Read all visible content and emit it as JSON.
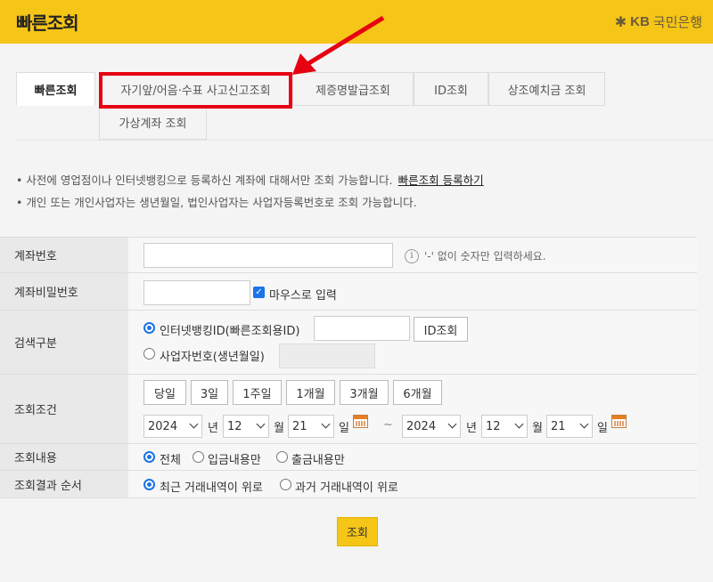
{
  "header": {
    "title": "빠른조회",
    "logo_text": "국민은행",
    "logo_kb": "KB",
    "logo_icon": "kb-star-icon"
  },
  "tabs": [
    {
      "label": "빠른조회",
      "active": true
    },
    {
      "label": "자기앞/어음·수표 사고신고조회",
      "active": false
    },
    {
      "label": "제증명발급조회",
      "active": false
    },
    {
      "label": "ID조회",
      "active": false
    },
    {
      "label": "상조예치금 조회",
      "active": false
    },
    {
      "label": "가상계좌 조회",
      "active": false
    }
  ],
  "notes": {
    "line1": "• 사전에 영업점이나 인터넷뱅킹으로 등록하신 계좌에 대해서만 조회 가능합니다.",
    "line1_link": "빠른조회 등록하기",
    "line2": "• 개인 또는 개인사업자는 생년월일, 법인사업자는 사업자등록번호로 조회 가능합니다."
  },
  "form": {
    "account_number": {
      "label": "계좌번호",
      "value": "",
      "hint": "'-' 없이 숫자만 입력하세요.",
      "info_icon": "i"
    },
    "account_password": {
      "label": "계좌비밀번호",
      "value": "",
      "mouse_input_label": "마우스로 입력",
      "mouse_input_checked": true
    },
    "search_type": {
      "label": "검색구분",
      "option1": "인터넷뱅킹ID(빠른조회용ID)",
      "option2": "사업자번호(생년월일)",
      "id_button": "ID조회",
      "selected": "option1"
    },
    "condition": {
      "label": "조회조건",
      "quick_buttons": [
        "당일",
        "3일",
        "1주일",
        "1개월",
        "3개월",
        "6개월"
      ],
      "from": {
        "year": "2024",
        "month": "12",
        "day": "21"
      },
      "to": {
        "year": "2024",
        "month": "12",
        "day": "21"
      },
      "year_unit": "년",
      "month_unit": "월",
      "day_unit": "일",
      "separator": "~"
    },
    "content": {
      "label": "조회내용",
      "options": [
        "전체",
        "입금내용만",
        "출금내용만"
      ],
      "selected": "전체"
    },
    "order": {
      "label": "조회결과 순서",
      "options": [
        "최근 거래내역이 위로",
        "과거 거래내역이 위로"
      ],
      "selected": "최근 거래내역이 위로"
    }
  },
  "submit_label": "조회",
  "colors": {
    "header_bg": "#f5c518",
    "highlight": "#e60012",
    "accent": "#1a73e8"
  }
}
